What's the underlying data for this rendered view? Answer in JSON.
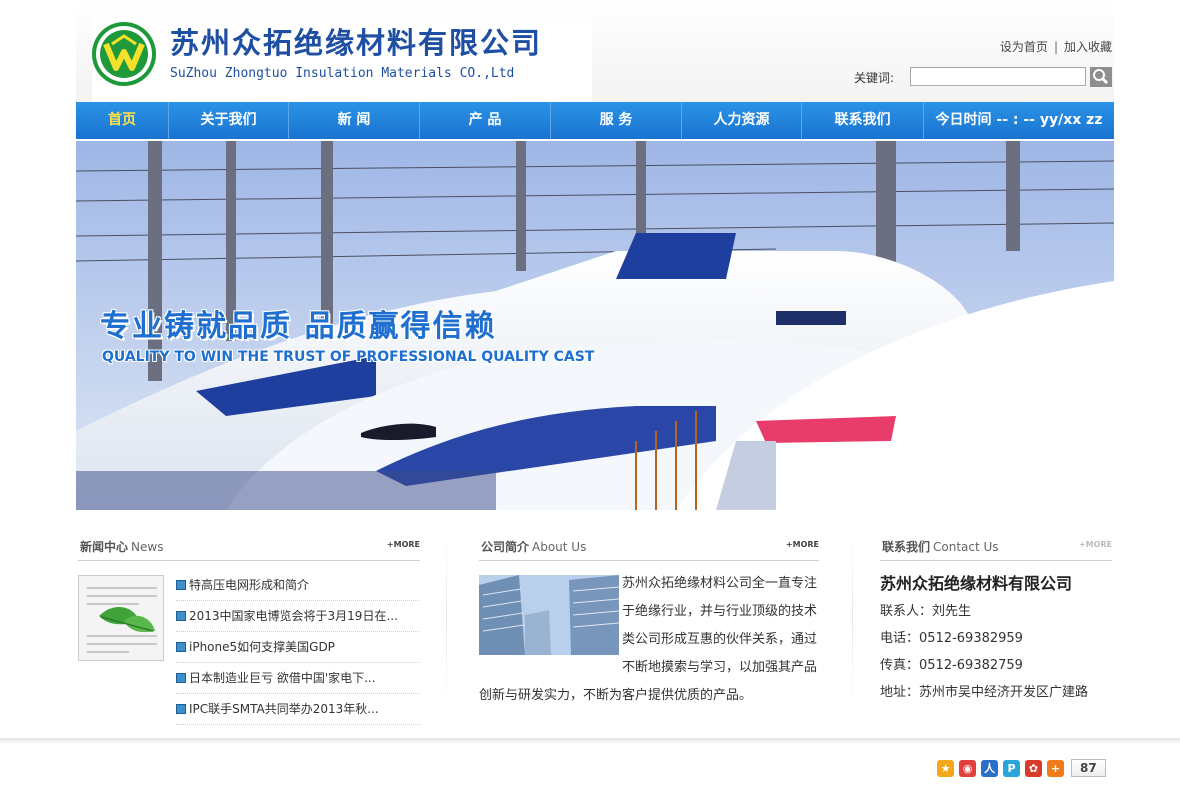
{
  "header": {
    "company_cn": "苏州众拓绝缘材料有限公司",
    "company_en": "SuZhou Zhongtuo Insulation Materials CO.,Ltd",
    "set_home": "设为首页",
    "separator": "|",
    "add_favorite": "加入收藏",
    "search_label": "关键词:",
    "search_value": "",
    "logo_color": "#1f9a3a",
    "brand_color": "#1e4fa3"
  },
  "nav": {
    "items": [
      {
        "label": "首页",
        "active": true
      },
      {
        "label": "关于我们"
      },
      {
        "label": "新 闻"
      },
      {
        "label": "产 品"
      },
      {
        "label": "服 务"
      },
      {
        "label": "人力资源"
      },
      {
        "label": "联系我们"
      }
    ],
    "clock": "今日时间 -- : -- yy/xx zz",
    "bar_color": "#1a73d0"
  },
  "banner": {
    "slogan_cn": "专业铸就品质 品质赢得信赖",
    "slogan_en": "QUALITY TO WIN THE TRUST OF PROFESSIONAL QUALITY CAST"
  },
  "news": {
    "title_cn": "新闻中心",
    "title_en": "News",
    "more": "+MORE",
    "items": [
      "特高压电网形成和简介",
      "2013中国家电博览会将于3月19日在...",
      "iPhone5如何支撑美国GDP",
      "日本制造业巨亏 欲借中国'家电下...",
      "IPC联手SMTA共同举办2013年秋..."
    ]
  },
  "about": {
    "title_cn": "公司简介",
    "title_en": "About Us",
    "more": "+MORE",
    "text": "苏州众拓绝缘材料公司全一直专注于绝缘行业，并与行业顶级的技术类公司形成互惠的伙伴关系，通过不断地摸索与学习，以加强其产品创新与研发实力，不断为客户提供优质的产品。"
  },
  "contact": {
    "title_cn": "联系我们",
    "title_en": "Contact Us",
    "more": "+MORE",
    "company": "苏州众拓绝缘材料有限公司",
    "person": "联系人：刘先生",
    "phone": "电话：0512-69382959",
    "fax": "传真：0512-69382759",
    "address": "地址：苏州市吴中经济开发区广建路"
  },
  "share": {
    "icons": [
      {
        "name": "qzone-share-icon",
        "glyph": "★",
        "color": "#f2a81d"
      },
      {
        "name": "weibo-share-icon",
        "glyph": "◉",
        "color": "#e0413a"
      },
      {
        "name": "renren-share-icon",
        "glyph": "人",
        "color": "#2a6fc9"
      },
      {
        "name": "tqq-share-icon",
        "glyph": "P",
        "color": "#2ba3db"
      },
      {
        "name": "tieba-share-icon",
        "glyph": "✿",
        "color": "#d93a2b"
      },
      {
        "name": "more-share-icon",
        "glyph": "+",
        "color": "#f07b1a"
      }
    ],
    "count": "87"
  }
}
